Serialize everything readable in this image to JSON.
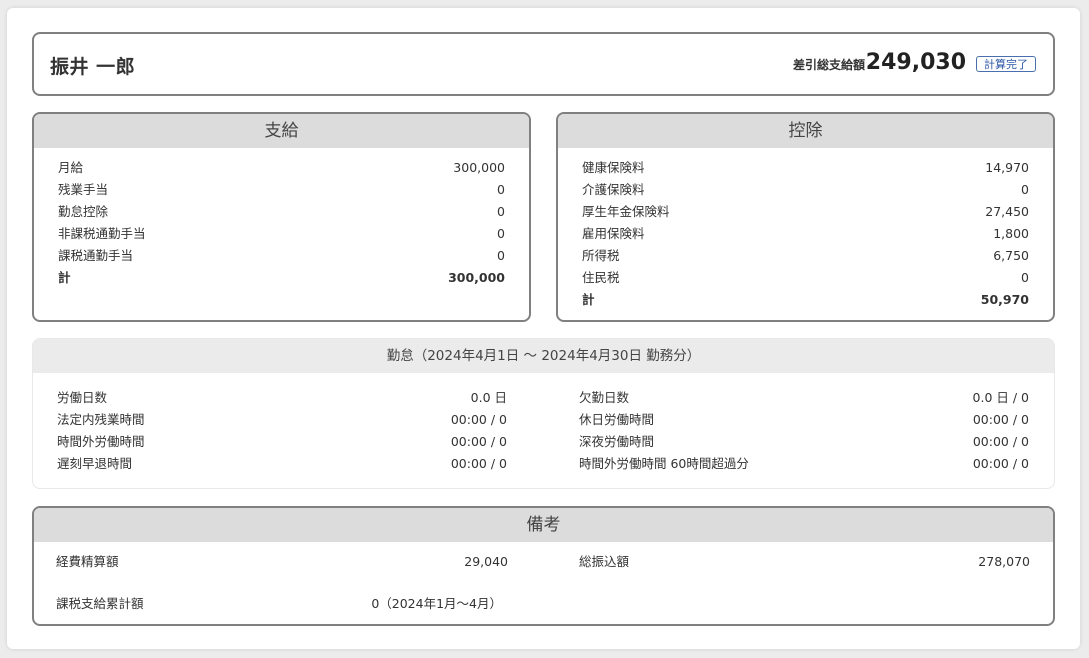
{
  "header": {
    "employee_name": "振井 一郎",
    "net_label": "差引総支給額",
    "net_value": "249,030",
    "status_badge": "計算完了"
  },
  "earnings": {
    "title": "支給",
    "rows": [
      {
        "label": "月給",
        "value": "300,000"
      },
      {
        "label": "残業手当",
        "value": "0"
      },
      {
        "label": "勤怠控除",
        "value": "0"
      },
      {
        "label": "非課税通勤手当",
        "value": "0"
      },
      {
        "label": "課税通勤手当",
        "value": "0"
      }
    ],
    "total": {
      "label": "計",
      "value": "300,000"
    }
  },
  "deductions": {
    "title": "控除",
    "rows": [
      {
        "label": "健康保険料",
        "value": "14,970"
      },
      {
        "label": "介護保険料",
        "value": "0"
      },
      {
        "label": "厚生年金保険料",
        "value": "27,450"
      },
      {
        "label": "雇用保険料",
        "value": "1,800"
      },
      {
        "label": "所得税",
        "value": "6,750"
      },
      {
        "label": "住民税",
        "value": "0"
      }
    ],
    "total": {
      "label": "計",
      "value": "50,970"
    }
  },
  "attendance": {
    "title": "勤怠（2024年4月1日 〜 2024年4月30日 勤務分）",
    "left": [
      {
        "label": "労働日数",
        "value": "0.0 日"
      },
      {
        "label": "法定内残業時間",
        "value": "00:00 / 0"
      },
      {
        "label": "時間外労働時間",
        "value": "00:00 / 0"
      },
      {
        "label": "遅刻早退時間",
        "value": "00:00 / 0"
      }
    ],
    "right": [
      {
        "label": "欠勤日数",
        "value": "0.0 日 / 0"
      },
      {
        "label": "休日労働時間",
        "value": "00:00 / 0"
      },
      {
        "label": "深夜労働時間",
        "value": "00:00 / 0"
      },
      {
        "label": "時間外労働時間 60時間超過分",
        "value": "00:00 / 0"
      }
    ]
  },
  "remarks": {
    "title": "備考",
    "expense_label": "経費精算額",
    "expense_value": "29,040",
    "transfer_label": "総振込額",
    "transfer_value": "278,070",
    "ytd_label": "課税支給累計額",
    "ytd_value": "0（2024年1月〜4月）"
  }
}
